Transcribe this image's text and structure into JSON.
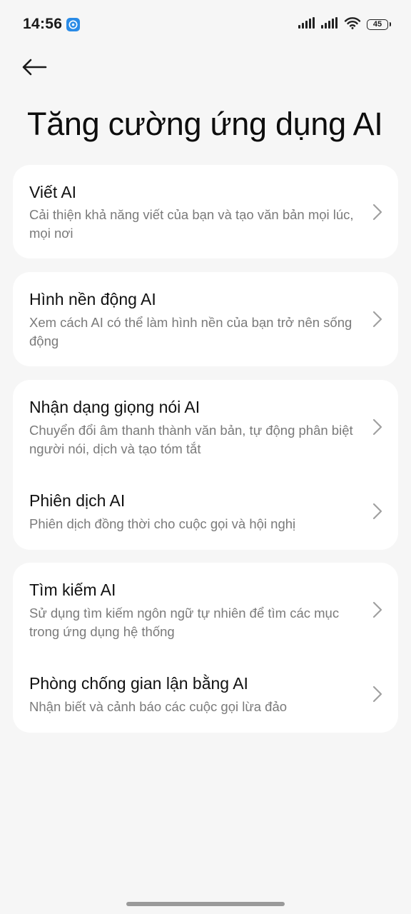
{
  "status_bar": {
    "time": "14:56",
    "battery": "45",
    "icons": [
      "app-notification-icon",
      "signal-icon",
      "signal-icon",
      "wifi-icon",
      "battery-icon"
    ]
  },
  "header": {
    "back_icon": "arrow-left-icon",
    "title": "Tăng cường ứng dụng AI"
  },
  "cards": [
    {
      "items": [
        {
          "title": "Viết AI",
          "description": "Cải thiện khả năng viết của bạn và tạo văn bản mọi lúc, mọi nơi"
        }
      ]
    },
    {
      "items": [
        {
          "title": "Hình nền động AI",
          "description": "Xem cách AI có thể làm hình nền của bạn trở nên sống động"
        }
      ]
    },
    {
      "items": [
        {
          "title": "Nhận dạng giọng nói AI",
          "description": "Chuyển đổi âm thanh thành văn bản, tự động phân biệt người nói, dịch và tạo tóm tắt"
        },
        {
          "title": "Phiên dịch AI",
          "description": "Phiên dịch đồng thời cho cuộc gọi và hội nghị"
        }
      ]
    },
    {
      "items": [
        {
          "title": "Tìm kiếm AI",
          "description": "Sử dụng tìm kiếm ngôn ngữ tự nhiên để tìm các mục trong ứng dụng hệ thống"
        },
        {
          "title": "Phòng chống gian lận bằng AI",
          "description": "Nhận biết và cảnh báo các cuộc gọi lừa đảo"
        }
      ]
    }
  ],
  "colors": {
    "background": "#f6f6f6",
    "card": "#ffffff",
    "title_text": "#111111",
    "description_text": "#7a7a7a",
    "chevron": "#a0a0a0"
  }
}
